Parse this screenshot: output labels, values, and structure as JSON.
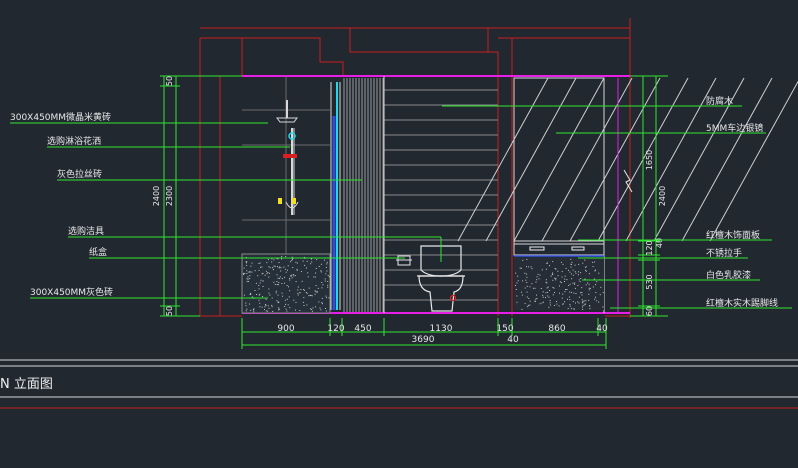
{
  "drawing_title": "N 立面图",
  "left_labels": [
    "300X450MM微晶米黄砖",
    "选购淋浴花洒",
    "灰色拉丝砖",
    "选购洁具",
    "纸盒",
    "300X450MM灰色砖"
  ],
  "right_labels": [
    "防腐木",
    "5MM车边银镜",
    "红檀木饰面板",
    "不锈拉手",
    "白色乳胶漆",
    "红檀木实木踢脚线"
  ],
  "bottom_dims": [
    "900",
    "120",
    "450",
    "1130",
    "150",
    "860",
    "40"
  ],
  "total_dim": "3690",
  "total_dim_sub": "40",
  "left_vdims": {
    "outer": "2400",
    "inner": "2300",
    "top": "50",
    "bottom": "50"
  },
  "right_vdims": {
    "outer": "2400",
    "upper": "1650",
    "mid_a": "120",
    "mid_b": "40",
    "lower": "530",
    "bottom": "60"
  },
  "colors": {
    "background": "#212830",
    "wall_red": "#c81e1e",
    "magenta": "#e61ee6",
    "leader_green": "#2ee62e",
    "line_white": "#d8d8d8",
    "cyan": "#22d8e8",
    "blue": "#2d4fe0"
  }
}
